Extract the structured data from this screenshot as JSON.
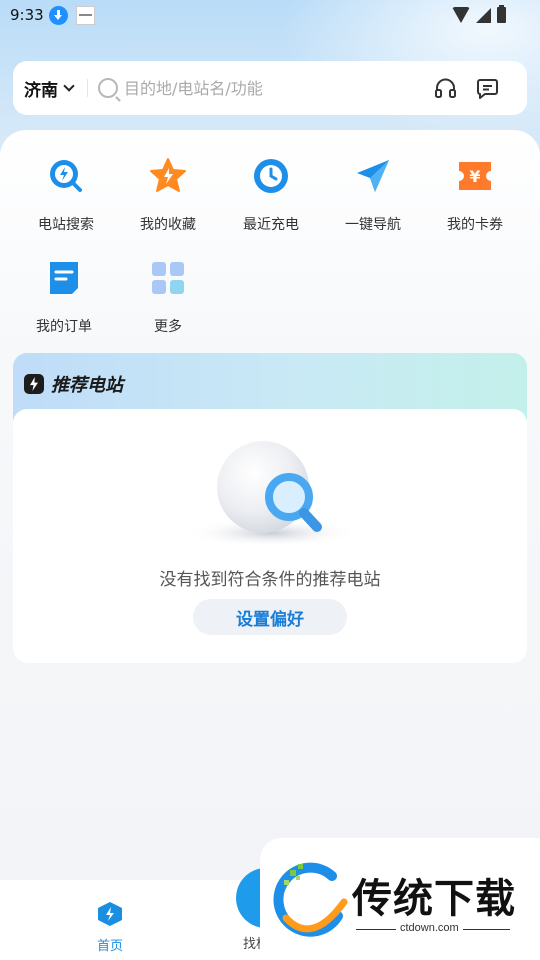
{
  "status_bar": {
    "time": "9:33"
  },
  "search": {
    "city": "济南",
    "placeholder": "目的地/电站名/功能"
  },
  "quick_actions": [
    {
      "label": "电站搜索",
      "icon": "station-search-icon"
    },
    {
      "label": "我的收藏",
      "icon": "star-favorite-icon"
    },
    {
      "label": "最近充电",
      "icon": "clock-recent-icon"
    },
    {
      "label": "一键导航",
      "icon": "paper-plane-navigation-icon"
    },
    {
      "label": "我的卡券",
      "icon": "coupon-yen-icon"
    },
    {
      "label": "我的订单",
      "icon": "order-document-icon"
    },
    {
      "label": "更多",
      "icon": "grid-more-icon"
    }
  ],
  "recommend": {
    "title": "推荐电站",
    "empty_text": "没有找到符合条件的推荐电站",
    "button_label": "设置偏好"
  },
  "bottom_nav": {
    "home_label": "首页",
    "find_label": "找桩"
  },
  "watermark": {
    "name": "传统下载",
    "url": "ctdown.com"
  },
  "colors": {
    "accent": "#1a8ee0",
    "primary_blue": "#1e9bea",
    "star_orange": "#ff8a1f",
    "coupon_orange": "#ff7a2a"
  }
}
